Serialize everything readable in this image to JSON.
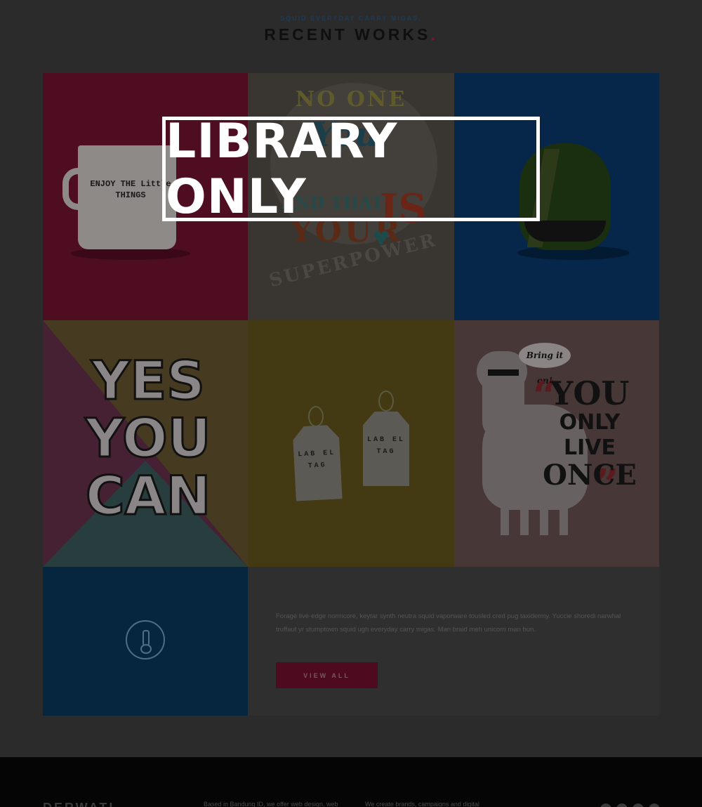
{
  "header": {
    "eyebrow": "SQUID EVERYDAY CARRY MIGAS.",
    "title": "RECENT WORKS",
    "title_dot": "."
  },
  "works": {
    "mug_text": "ENJOY THE Little THINGS",
    "badge": {
      "top": "NO ONE",
      "is": "IS",
      "you": "You",
      "and_that": "AND THAT",
      "big_is": "IS",
      "your": "YOUR",
      "bottom": "SUPERPOWER"
    },
    "yes_you_can": "YES YOU CAN",
    "tag_label": "LAB EL TAG",
    "speech": "Bring it on!",
    "yolo": [
      "YOU",
      "ONLY LIVE",
      "ONCE"
    ]
  },
  "about": {
    "text": "Forage live-edge normcore, keytar synth neutra squid vaporware tousled cred pug taxidermy. Yuccie shoredi narwhal truffaut yr stumptown squid ugh everyday carry migas. Man braid meh unicorn man bun.",
    "button_label": "VIEW ALL"
  },
  "footer": {
    "brand": "DERWATI",
    "col1": "Based in Bandung ID, we offer web design, web",
    "col2": "We create brands, campaigns and digital"
  },
  "watermark": "LIBRARY ONLY"
}
